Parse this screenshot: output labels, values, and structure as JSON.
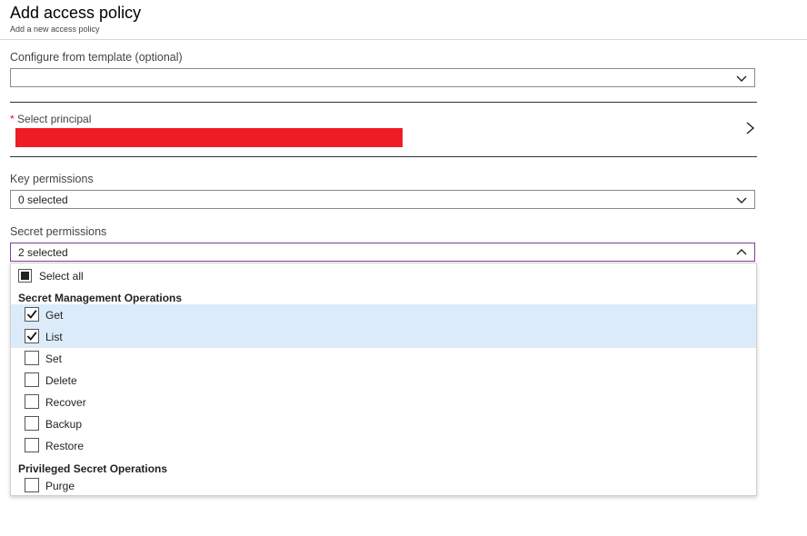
{
  "header": {
    "title": "Add access policy",
    "subtitle": "Add a new access policy"
  },
  "template": {
    "label": "Configure from template (optional)",
    "value": ""
  },
  "principal": {
    "required_mark": "*",
    "label": "Select principal"
  },
  "key_permissions": {
    "label": "Key permissions",
    "value": "0 selected"
  },
  "secret_permissions": {
    "label": "Secret permissions",
    "value": "2 selected",
    "select_all": "Select all",
    "groups": [
      {
        "title": "Secret Management Operations",
        "items": [
          {
            "label": "Get",
            "checked": true
          },
          {
            "label": "List",
            "checked": true
          },
          {
            "label": "Set",
            "checked": false
          },
          {
            "label": "Delete",
            "checked": false
          },
          {
            "label": "Recover",
            "checked": false
          },
          {
            "label": "Backup",
            "checked": false
          },
          {
            "label": "Restore",
            "checked": false
          }
        ]
      },
      {
        "title": "Privileged Secret Operations",
        "items": [
          {
            "label": "Purge",
            "checked": false
          }
        ]
      }
    ]
  },
  "colors": {
    "selected_row": "#dcebfa",
    "open_border": "#7f3f98",
    "required": "#e81123",
    "redaction": "#ee1c25"
  }
}
